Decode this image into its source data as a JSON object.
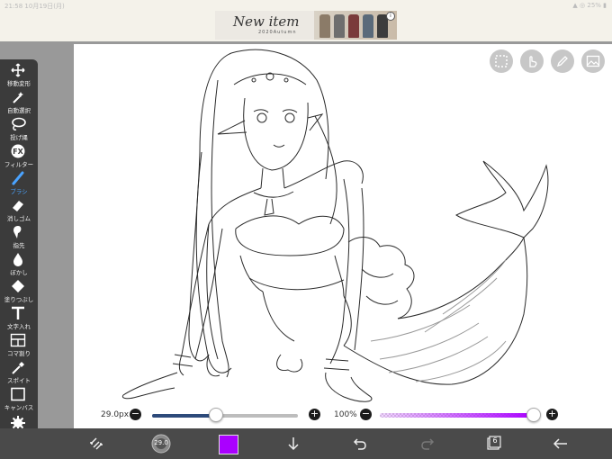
{
  "status_bar": {
    "time": "21:58",
    "date": "10月19日(月)",
    "battery": "25%"
  },
  "ad": {
    "title": "New item",
    "subtitle": "2020Autumn",
    "info_icon": "info-icon"
  },
  "tools": [
    {
      "label": "移動変形",
      "icon": "move-icon"
    },
    {
      "label": "自動選択",
      "icon": "magic-wand-icon"
    },
    {
      "label": "投げ縄",
      "icon": "lasso-icon"
    },
    {
      "label": "フィルター",
      "icon": "fx-icon"
    },
    {
      "label": "ブラシ",
      "icon": "brush-icon",
      "active": true
    },
    {
      "label": "消しゴム",
      "icon": "eraser-icon"
    },
    {
      "label": "指先",
      "icon": "finger-icon"
    },
    {
      "label": "ぼかし",
      "icon": "blur-drop-icon"
    },
    {
      "label": "塗りつぶし",
      "icon": "fill-bucket-icon"
    },
    {
      "label": "文字入れ",
      "icon": "text-icon"
    },
    {
      "label": "コマ割り",
      "icon": "frame-divider-icon"
    },
    {
      "label": "スポイト",
      "icon": "eyedropper-icon"
    },
    {
      "label": "キャンバス",
      "icon": "canvas-icon"
    },
    {
      "label": "設定",
      "icon": "gear-icon"
    }
  ],
  "brush_size": {
    "value": "29.0px",
    "fraction": 0.43
  },
  "opacity": {
    "value": "100%",
    "fraction": 1.0
  },
  "brush_preview_value": "29.0",
  "current_color": "#aa00ff",
  "layer_count": "6",
  "colors": {
    "toolbar": "#3b3b3b",
    "bottom_bar": "#4a4a4a",
    "accent": "#4aa3ff",
    "size_fill": "#2d4a7a"
  }
}
